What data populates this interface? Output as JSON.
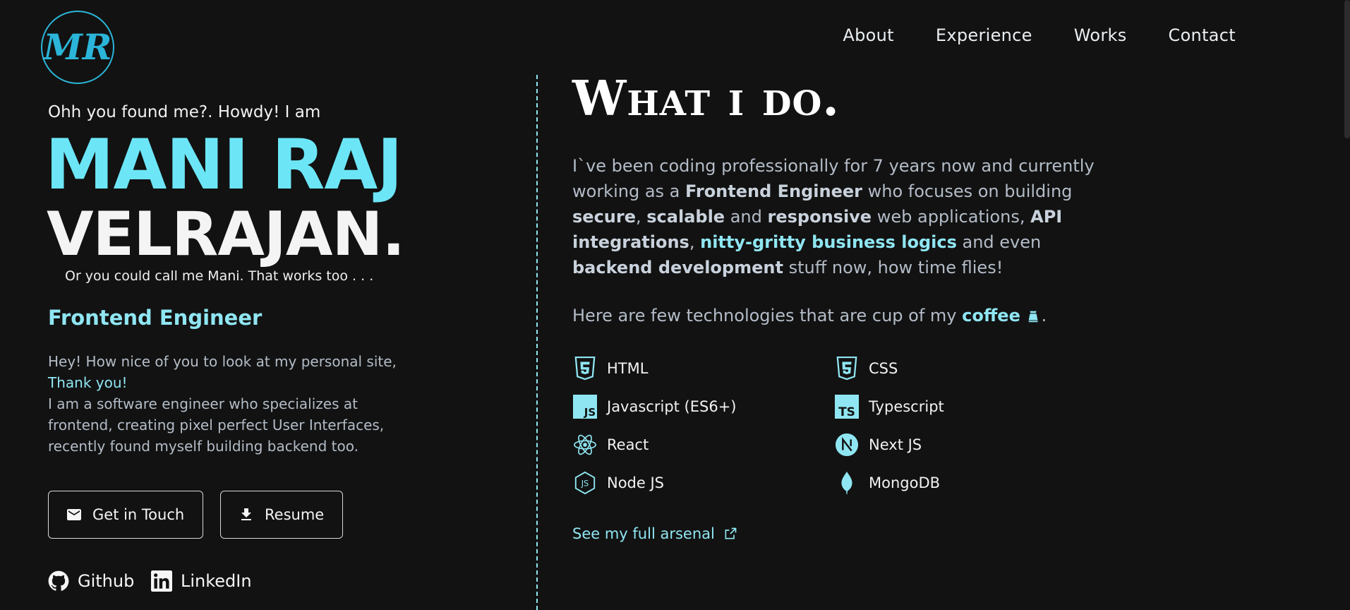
{
  "logo": {
    "text": "MR"
  },
  "nav": [
    {
      "label": "About"
    },
    {
      "label": "Experience"
    },
    {
      "label": "Works"
    },
    {
      "label": "Contact"
    }
  ],
  "hero": {
    "intro": "Ohh you found me?. Howdy! I am",
    "first_name": "MANI RAJ",
    "last_name": "VELRAJAN.",
    "nickname": "Or you could call me Mani. That works too . . .",
    "role": "Frontend Engineer",
    "bio_line1": "Hey! How nice of you to look at my personal site,",
    "bio_thanks": "Thank you!",
    "bio_line2": "I am a software engineer who specializes at frontend, creating pixel perfect User Interfaces, recently found myself building backend too."
  },
  "buttons": {
    "touch": "Get in Touch",
    "resume": "Resume"
  },
  "social": {
    "github": "Github",
    "linkedin": "LinkedIn"
  },
  "whatido": {
    "heading": "What i do.",
    "p1": "I`ve been coding professionally for 7 years now and currently working as a ",
    "b1": "Frontend Engineer",
    "p2": " who focuses on building ",
    "b2": "secure",
    "p3": ", ",
    "b3": "scalable",
    "p4": " and ",
    "b4": "responsive",
    "p5": " web applications, ",
    "b5": "API integrations",
    "p6": ", ",
    "b6": "nitty-gritty business logics",
    "p7": " and even ",
    "b7": "backend development",
    "p8": " stuff now, how time flies!",
    "coffee_prefix": "Here are few technologies that are cup of my ",
    "coffee_word": "coffee",
    "coffee_suffix": "."
  },
  "technologies": [
    {
      "label": "HTML",
      "icon": "html5-icon"
    },
    {
      "label": "CSS",
      "icon": "css3-icon"
    },
    {
      "label": "Javascript (ES6+)",
      "icon": "javascript-icon"
    },
    {
      "label": "Typescript",
      "icon": "typescript-icon"
    },
    {
      "label": "React",
      "icon": "react-icon"
    },
    {
      "label": "Next JS",
      "icon": "nextjs-icon"
    },
    {
      "label": "Node JS",
      "icon": "nodejs-icon"
    },
    {
      "label": "MongoDB",
      "icon": "mongodb-icon"
    }
  ],
  "arsenal_link": "See my full arsenal",
  "colors": {
    "background": "#121212",
    "accent": "#6ce6f6",
    "accent_soft": "#8fe6f2",
    "muted_text": "#b3bcc7"
  }
}
